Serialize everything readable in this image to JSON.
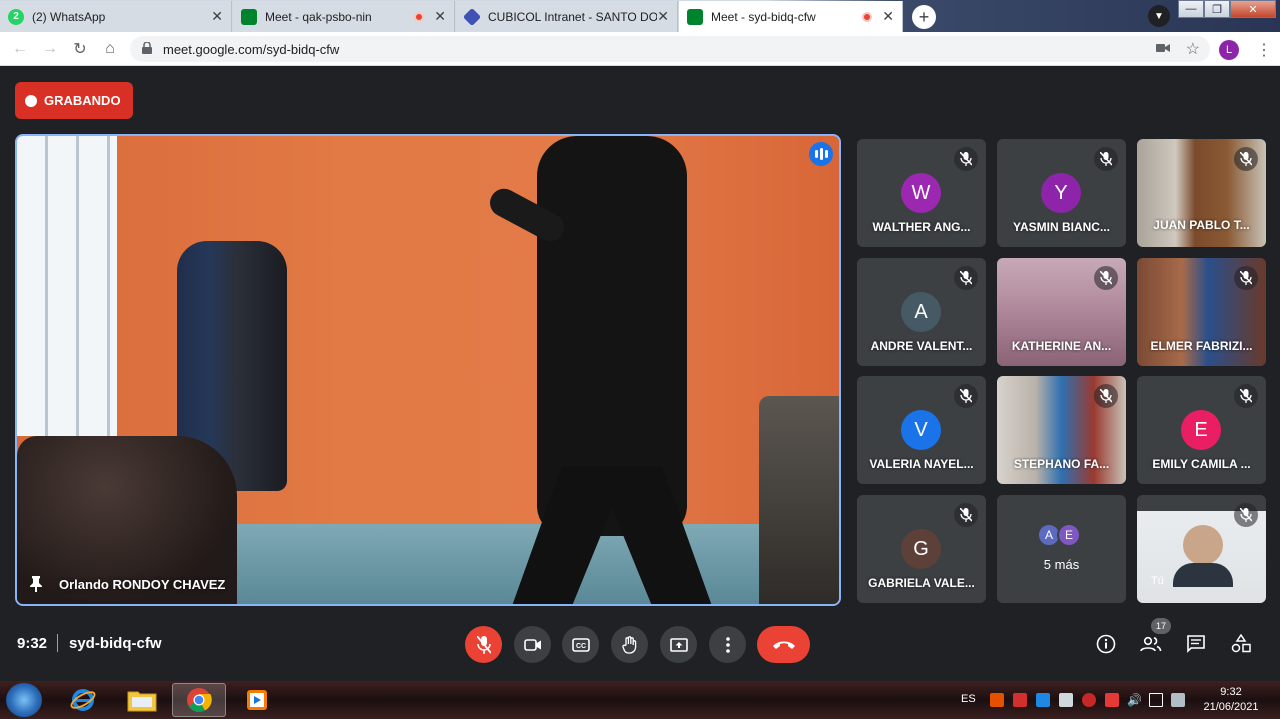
{
  "browser": {
    "tabs": [
      {
        "title": "(2) WhatsApp",
        "favicon_text": "2",
        "favicon_color": "#25d366",
        "recording": false,
        "active": false
      },
      {
        "title": "Meet - qak-psbo-nin",
        "favicon_text": "",
        "favicon_color": "#00832d",
        "recording": true,
        "active": false
      },
      {
        "title": "CUBICOL Intranet - SANTO DOMI",
        "favicon_text": "",
        "favicon_color": "#3f51b5",
        "recording": false,
        "active": false
      },
      {
        "title": "Meet - syd-bidq-cfw",
        "favicon_text": "",
        "favicon_color": "#00832d",
        "recording": true,
        "active": true
      }
    ],
    "url": "meet.google.com/syd-bidq-cfw",
    "profile_initial": "L"
  },
  "meeting": {
    "recording_label": "GRABANDO",
    "main_speaker": "Orlando RONDOY CHAVEZ",
    "time": "9:32",
    "code": "syd-bidq-cfw",
    "participant_count": "17"
  },
  "participants": [
    {
      "name": "WALTHER ANG...",
      "initial": "W",
      "color": "#9c27b0"
    },
    {
      "name": "YASMIN BIANC...",
      "initial": "Y",
      "color": "#8e24aa"
    },
    {
      "name": "JUAN PABLO T...",
      "initial": "",
      "color": ""
    },
    {
      "name": "ANDRE VALENT...",
      "initial": "A",
      "color": "#455a64"
    },
    {
      "name": "KATHERINE AN...",
      "initial": "",
      "color": ""
    },
    {
      "name": "ELMER FABRIZI...",
      "initial": "",
      "color": ""
    },
    {
      "name": "VALERIA NAYEL...",
      "initial": "V",
      "color": "#1a73e8"
    },
    {
      "name": "STEPHANO FA...",
      "initial": "",
      "color": ""
    },
    {
      "name": "EMILY CAMILA ...",
      "initial": "E",
      "color": "#e91e63"
    },
    {
      "name": "GABRIELA VALE...",
      "initial": "G",
      "color": "#5d4037"
    }
  ],
  "more_tile": {
    "label": "5 más",
    "avatars": [
      {
        "initial": "A",
        "color": "#5c6bc0"
      },
      {
        "initial": "E",
        "color": "#7e57c2"
      }
    ]
  },
  "self_tile": {
    "label": "Tú"
  },
  "taskbar": {
    "language": "ES",
    "time": "9:32",
    "date": "21/06/2021"
  }
}
